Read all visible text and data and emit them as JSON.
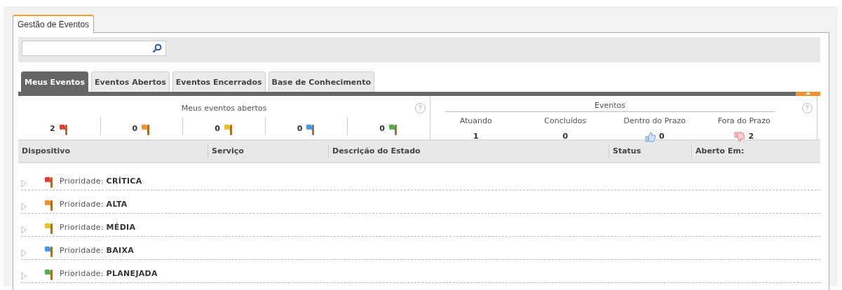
{
  "window_tab": {
    "label": "Gestão de Eventos",
    "selected": true
  },
  "tabs": [
    {
      "label": "Meus Eventos",
      "selected": true
    },
    {
      "label": "Eventos Abertos",
      "selected": false
    },
    {
      "label": "Eventos Encerrados",
      "selected": false
    },
    {
      "label": "Base de Conhecimento",
      "selected": false
    }
  ],
  "my_open_events": {
    "title": "Meus eventos abertos",
    "help": "?",
    "counts": [
      {
        "value": "2",
        "color": "#e83a3a"
      },
      {
        "value": "0",
        "color": "#f0902e"
      },
      {
        "value": "0",
        "color": "#e8c21e"
      },
      {
        "value": "0",
        "color": "#3d9ae8"
      },
      {
        "value": "0",
        "color": "#4cae4c"
      }
    ]
  },
  "events": {
    "title": "Eventos",
    "help": "?",
    "stats": [
      {
        "label": "Atuando",
        "value": "1",
        "kind": "plain"
      },
      {
        "label": "Concluídos",
        "value": "0",
        "kind": "plain"
      },
      {
        "label": "Dentro do Prazo",
        "value": "0",
        "kind": "thumbs_up"
      },
      {
        "label": "Fora do Prazo",
        "value": "2",
        "kind": "thumbs_down"
      }
    ]
  },
  "table": {
    "columns": [
      "Dispositivo",
      "Serviço",
      "Descrição do Estado",
      "Status",
      "Aberto Em:"
    ],
    "groups": [
      {
        "label": "Prioridade: **CRÍTICA**",
        "color": "#e83a3a",
        "expanded": false
      },
      {
        "label": "Prioridade: **ALTA**",
        "color": "#f0902e",
        "expanded": false
      },
      {
        "label": "Prioridade: **MÉDIA**",
        "color": "#e8c21e",
        "expanded": false
      },
      {
        "label": "Prioridade: **BAIXA**",
        "color": "#3d9ae8",
        "expanded": false
      },
      {
        "label": "Prioridade: **PLANEJADA**",
        "color": "#4cae4c",
        "expanded": false
      }
    ]
  }
}
